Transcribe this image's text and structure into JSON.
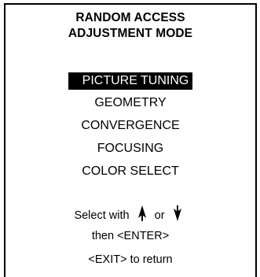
{
  "osd": {
    "title_line1": "RANDOM ACCESS",
    "title_line2": "ADJUSTMENT MODE",
    "menu_items": [
      {
        "label": "PICTURE TUNING",
        "selected": true
      },
      {
        "label": "GEOMETRY",
        "selected": false
      },
      {
        "label": "CONVERGENCE",
        "selected": false
      },
      {
        "label": "FOCUSING",
        "selected": false
      },
      {
        "label": "COLOR SELECT",
        "selected": false
      }
    ],
    "help": {
      "select_prefix": "Select with",
      "select_or": "or",
      "up_icon": "arrow-up-icon",
      "down_icon": "arrow-down-icon",
      "enter_line": "then <ENTER>",
      "exit_line": "<EXIT> to return"
    }
  }
}
